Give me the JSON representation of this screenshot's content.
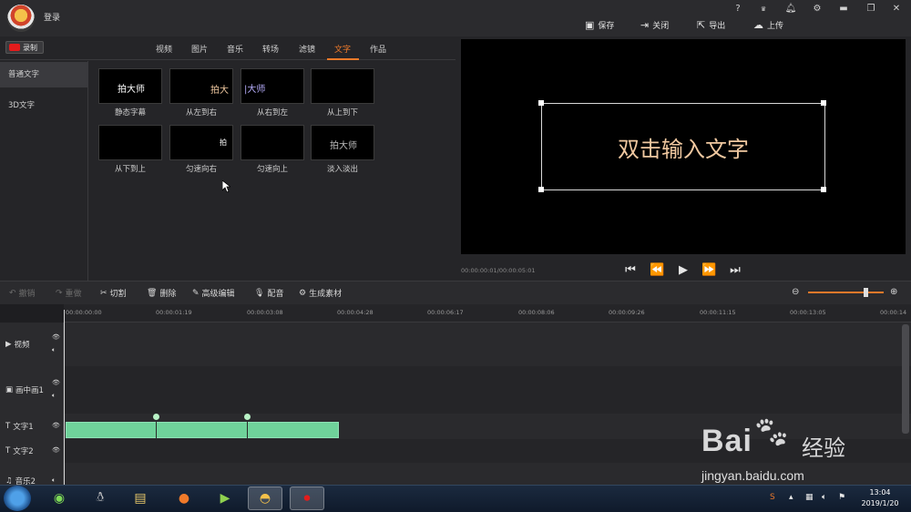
{
  "titlebar": {
    "login": "登录",
    "window_controls": [
      "?",
      "VIP",
      "bell-icon",
      "gear-icon",
      "minimize-icon",
      "maximize-icon",
      "close-icon"
    ],
    "actions": [
      {
        "icon": "save-icon",
        "label": "保存"
      },
      {
        "icon": "close-door-icon",
        "label": "关闭"
      },
      {
        "icon": "export-icon",
        "label": "导出"
      },
      {
        "icon": "upload-icon",
        "label": "上传"
      }
    ]
  },
  "library": {
    "record_label": "录制",
    "tabs": [
      "视频",
      "图片",
      "音乐",
      "转场",
      "滤镜",
      "文字",
      "作品"
    ],
    "active_tab": "文字",
    "categories": [
      "普通文字",
      "3D文字"
    ],
    "active_category": "普通文字",
    "thumbs": [
      {
        "preview": "拍大师",
        "label": "静态字幕"
      },
      {
        "preview": "拍大",
        "label": "从左到右"
      },
      {
        "preview": "|大师",
        "label": "从右到左"
      },
      {
        "preview": "",
        "label": "从上到下"
      },
      {
        "preview": "",
        "label": "从下到上"
      },
      {
        "preview": "拍",
        "label": "匀速向右"
      },
      {
        "preview": "",
        "label": "匀速向上"
      },
      {
        "preview": "拍大师",
        "label": "淡入淡出"
      }
    ]
  },
  "preview": {
    "caption_text": "双击输入文字",
    "timecode": "00:00:00:01/00:00:05:01"
  },
  "toolbar": {
    "undo": "撤销",
    "redo": "重做",
    "cut": "切割",
    "delete": "删除",
    "advanced_edit": "高级编辑",
    "dub": "配音",
    "generate": "生成素材",
    "zoom_level": 0.78
  },
  "timeline": {
    "ruler": [
      "00:00:00:00",
      "00:00:01:19",
      "00:00:03:08",
      "00:00:04:28",
      "00:00:06:17",
      "00:00:08:06",
      "00:00:09:26",
      "00:00:11:15",
      "00:00:13:05",
      "00:00:14"
    ],
    "tracks": [
      "视频",
      "画中画1",
      "文字1",
      "文字2",
      "音乐2"
    ]
  },
  "taskbar": {
    "time": "13:04",
    "date": "2019/1/20"
  },
  "watermark": {
    "brand": "Bai",
    "brand_cn": "经验",
    "url": "jingyan.baidu.com"
  }
}
